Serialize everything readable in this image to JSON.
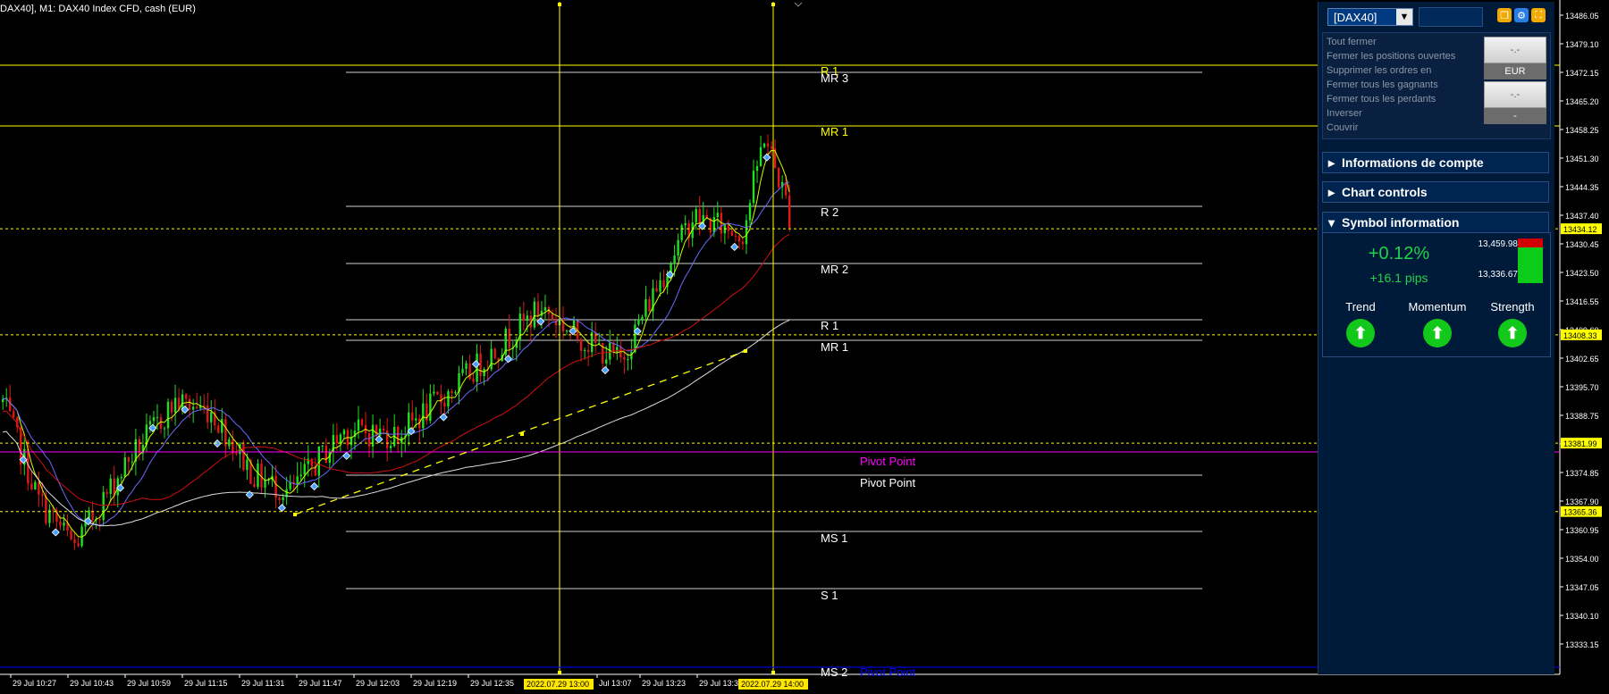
{
  "window_title": "DAX40], M1:  DAX40 Index CFD, cash (EUR)",
  "price_axis": {
    "labels": [
      "13486.05",
      "13479.10",
      "13472.15",
      "13465.20",
      "13458.25",
      "13451.30",
      "13444.35",
      "13437.40",
      "13430.45",
      "13423.50",
      "13416.55",
      "13409.60",
      "13402.65",
      "13395.70",
      "13388.75",
      "13381.80",
      "13374.85",
      "13367.90",
      "13360.95",
      "13354.00",
      "13347.05",
      "13340.10",
      "13333.15"
    ],
    "badges": [
      {
        "price": "13434.12",
        "color": "#ffff00"
      },
      {
        "price": "13408.33",
        "color": "#ffff00"
      },
      {
        "price": "13381.99",
        "color": "#ffff00"
      },
      {
        "price": "13365.36",
        "color": "#ffff00"
      }
    ]
  },
  "time_axis": {
    "labels": [
      "29 Jul 10:27",
      "29 Jul 10:43",
      "29 Jul 10:59",
      "29 Jul 11:15",
      "29 Jul 11:31",
      "29 Jul 11:47",
      "29 Jul 12:03",
      "29 Jul 12:19",
      "29 Jul 12:35",
      "Jul 13:07",
      "29 Jul 13:23",
      "29 Jul 13:3"
    ],
    "highlight": [
      "2022.07.29 13:00",
      "2022.07.29 14:00"
    ]
  },
  "levels": [
    {
      "label": "R 1",
      "color": "#ffff00"
    },
    {
      "label": "MR 3",
      "color": "#ffffff"
    },
    {
      "label": "MR 1",
      "color": "#ffff00"
    },
    {
      "label": "R 2",
      "color": "#ffffff"
    },
    {
      "label": "MR 2",
      "color": "#ffffff"
    },
    {
      "label": "R 1",
      "color": "#ffffff"
    },
    {
      "label": "MR 1",
      "color": "#ffffff"
    },
    {
      "label": "Pivot Point",
      "color": "#ff00ff"
    },
    {
      "label": "Pivot Point",
      "color": "#ffffff"
    },
    {
      "label": "MS 1",
      "color": "#ffffff"
    },
    {
      "label": "S 1",
      "color": "#ffffff"
    },
    {
      "label": "MS 2",
      "color": "#ffffff"
    },
    {
      "label": "Pivot Point",
      "color": "#0000ff"
    }
  ],
  "panel": {
    "symbol": "[DAX40]",
    "ops": [
      "Tout fermer",
      "Fermer les positions ouvertes",
      "Supprimer les ordres en",
      "Fermer tous les gagnants",
      "Fermer tous les perdants",
      "Inverser",
      "Couvrir"
    ],
    "box1_top": "-.-",
    "box1_bottom": "EUR",
    "box2_top": "-.-",
    "box2_bottom": "-",
    "sections": {
      "account": "Informations de compte",
      "chart_controls": "Chart controls",
      "symbol_info": "Symbol information"
    },
    "symbol_info": {
      "pct": "+0.12%",
      "pips": "+16.1 pips",
      "high": "13,459.98",
      "low": "13,336.67",
      "indicators": [
        {
          "label": "Trend",
          "direction": "up"
        },
        {
          "label": "Momentum",
          "direction": "up"
        },
        {
          "label": "Strength",
          "direction": "up"
        }
      ]
    },
    "colors": {
      "up": "#12c81a",
      "down": "#d20000",
      "accent": "#ffff00"
    }
  }
}
